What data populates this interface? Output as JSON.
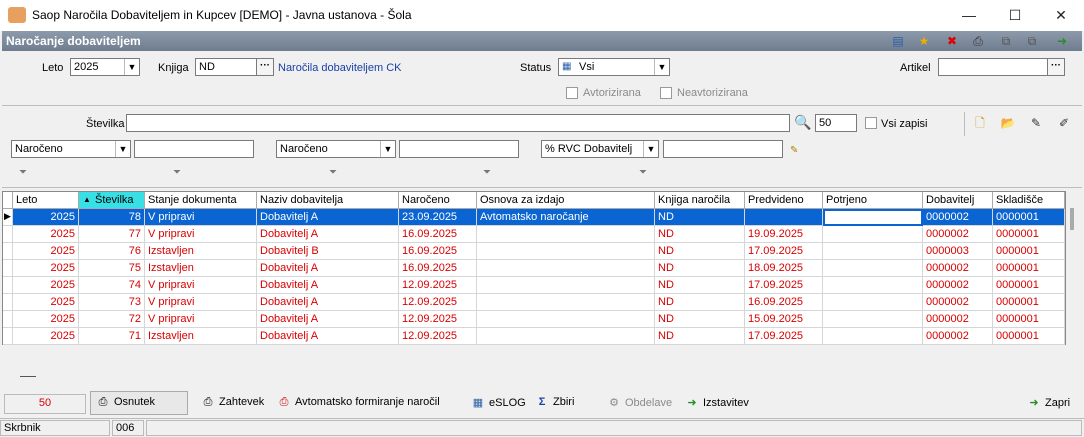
{
  "window": {
    "title": "Saop  Naročila Dobaviteljem in Kupcev [DEMO] - Javna ustanova - Šola",
    "minimize": "—",
    "maximize": "☐",
    "close": "✕"
  },
  "panel": {
    "title": "Naročanje dobaviteljem"
  },
  "toolbar_icons": [
    "list-icon",
    "star-icon",
    "delete-icon",
    "print-icon",
    "copy-icon",
    "copy2-icon",
    "exit-icon"
  ],
  "filters": {
    "leto_label": "Leto",
    "leto_value": "2025",
    "knjiga_label": "Knjiga",
    "knjiga_value": "ND",
    "knjiga_desc": "Naročila dobaviteljem CK",
    "status_label": "Status",
    "status_value": "Vsi",
    "artikel_label": "Artikel",
    "artikel_value": "",
    "avtorizirana_label": "Avtorizirana",
    "neavtorizirana_label": "Neavtorizirana"
  },
  "search": {
    "stevilka_label": "Številka",
    "stevilka_value": "",
    "count_value": "50",
    "vsi_zapisi_label": "Vsi zapisi",
    "combo1": "Naročeno",
    "combo2": "Naročeno",
    "combo3": "% RVC Dobavitelj"
  },
  "grid": {
    "columns": [
      "Leto",
      "Številka",
      "Stanje dokumenta",
      "Naziv dobavitelja",
      "Naročeno",
      "Osnova za izdajo",
      "Knjiga naročila",
      "Predvideno",
      "Potrjeno",
      "Dobavitelj",
      "Skladišče"
    ],
    "rows": [
      [
        "2025",
        "78",
        "V pripravi",
        "Dobavitelj A",
        "23.09.2025",
        "Avtomatsko naročanje",
        "ND",
        "",
        "",
        "0000002",
        "0000001"
      ],
      [
        "2025",
        "77",
        "V pripravi",
        "Dobavitelj A",
        "16.09.2025",
        "",
        "ND",
        "19.09.2025",
        "",
        "0000002",
        "0000001"
      ],
      [
        "2025",
        "76",
        "Izstavljen",
        "Dobavitelj B",
        "16.09.2025",
        "",
        "ND",
        "17.09.2025",
        "",
        "0000003",
        "0000001"
      ],
      [
        "2025",
        "75",
        "Izstavljen",
        "Dobavitelj A",
        "16.09.2025",
        "",
        "ND",
        "18.09.2025",
        "",
        "0000002",
        "0000001"
      ],
      [
        "2025",
        "74",
        "V pripravi",
        "Dobavitelj A",
        "12.09.2025",
        "",
        "ND",
        "17.09.2025",
        "",
        "0000002",
        "0000001"
      ],
      [
        "2025",
        "73",
        "V pripravi",
        "Dobavitelj A",
        "12.09.2025",
        "",
        "ND",
        "16.09.2025",
        "",
        "0000002",
        "0000001"
      ],
      [
        "2025",
        "72",
        "V pripravi",
        "Dobavitelj A",
        "12.09.2025",
        "",
        "ND",
        "15.09.2025",
        "",
        "0000002",
        "0000001"
      ],
      [
        "2025",
        "71",
        "Izstavljen",
        "Dobavitelj A",
        "12.09.2025",
        "",
        "ND",
        "17.09.2025",
        "",
        "0000002",
        "0000001"
      ]
    ]
  },
  "bottom": {
    "count": "50",
    "osnutek": "Osnutek",
    "zahtevek": "Zahtevek",
    "avtomatsko": "Avtomatsko formiranje naročil",
    "eslog": "eSLOG",
    "zbiri": "Zbiri",
    "obdelave": "Obdelave",
    "izstavitev": "Izstavitev",
    "zapri": "Zapri"
  },
  "status": {
    "user": "Skrbnik",
    "code": "006"
  }
}
